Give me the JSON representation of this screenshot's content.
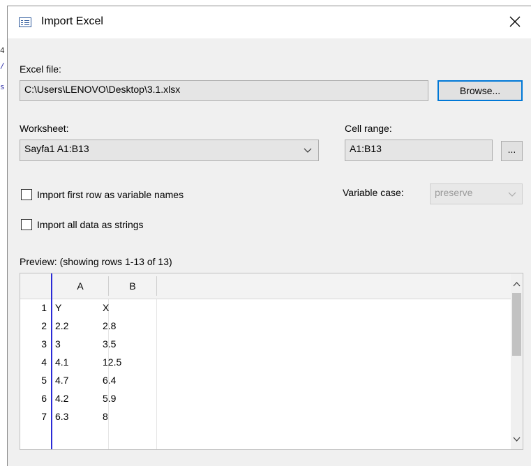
{
  "background": {
    "fragments": [
      "4",
      "/",
      "s"
    ]
  },
  "dialog": {
    "title": "Import Excel",
    "icon": "table-import-icon",
    "close_icon": "close-icon"
  },
  "excel_file": {
    "label": "Excel file:",
    "value": "C:\\Users\\LENOVO\\Desktop\\3.1.xlsx",
    "browse_label": "Browse..."
  },
  "worksheet": {
    "label": "Worksheet:",
    "selected": "Sayfa1 A1:B13"
  },
  "cell_range": {
    "label": "Cell range:",
    "value": "A1:B13",
    "picker_label": "..."
  },
  "options": {
    "first_row_label": "Import first row as variable names",
    "first_row_checked": false,
    "strings_label": "Import all data as strings",
    "strings_checked": false,
    "variable_case_label": "Variable case:",
    "variable_case_value": "preserve"
  },
  "preview": {
    "label": "Preview: (showing rows 1-13 of 13)",
    "columns": [
      "A",
      "B"
    ],
    "rows": [
      {
        "n": "1",
        "a": "Y",
        "b": "X"
      },
      {
        "n": "2",
        "a": "2.2",
        "b": "2.8"
      },
      {
        "n": "3",
        "a": "3",
        "b": "3.5"
      },
      {
        "n": "4",
        "a": "4.1",
        "b": "12.5"
      },
      {
        "n": "5",
        "a": "4.7",
        "b": "6.4"
      },
      {
        "n": "6",
        "a": "4.2",
        "b": "5.9"
      },
      {
        "n": "7",
        "a": "6.3",
        "b": "8"
      }
    ]
  },
  "colors": {
    "accent": "#0078d7",
    "selection_line": "#2b2bd6"
  }
}
